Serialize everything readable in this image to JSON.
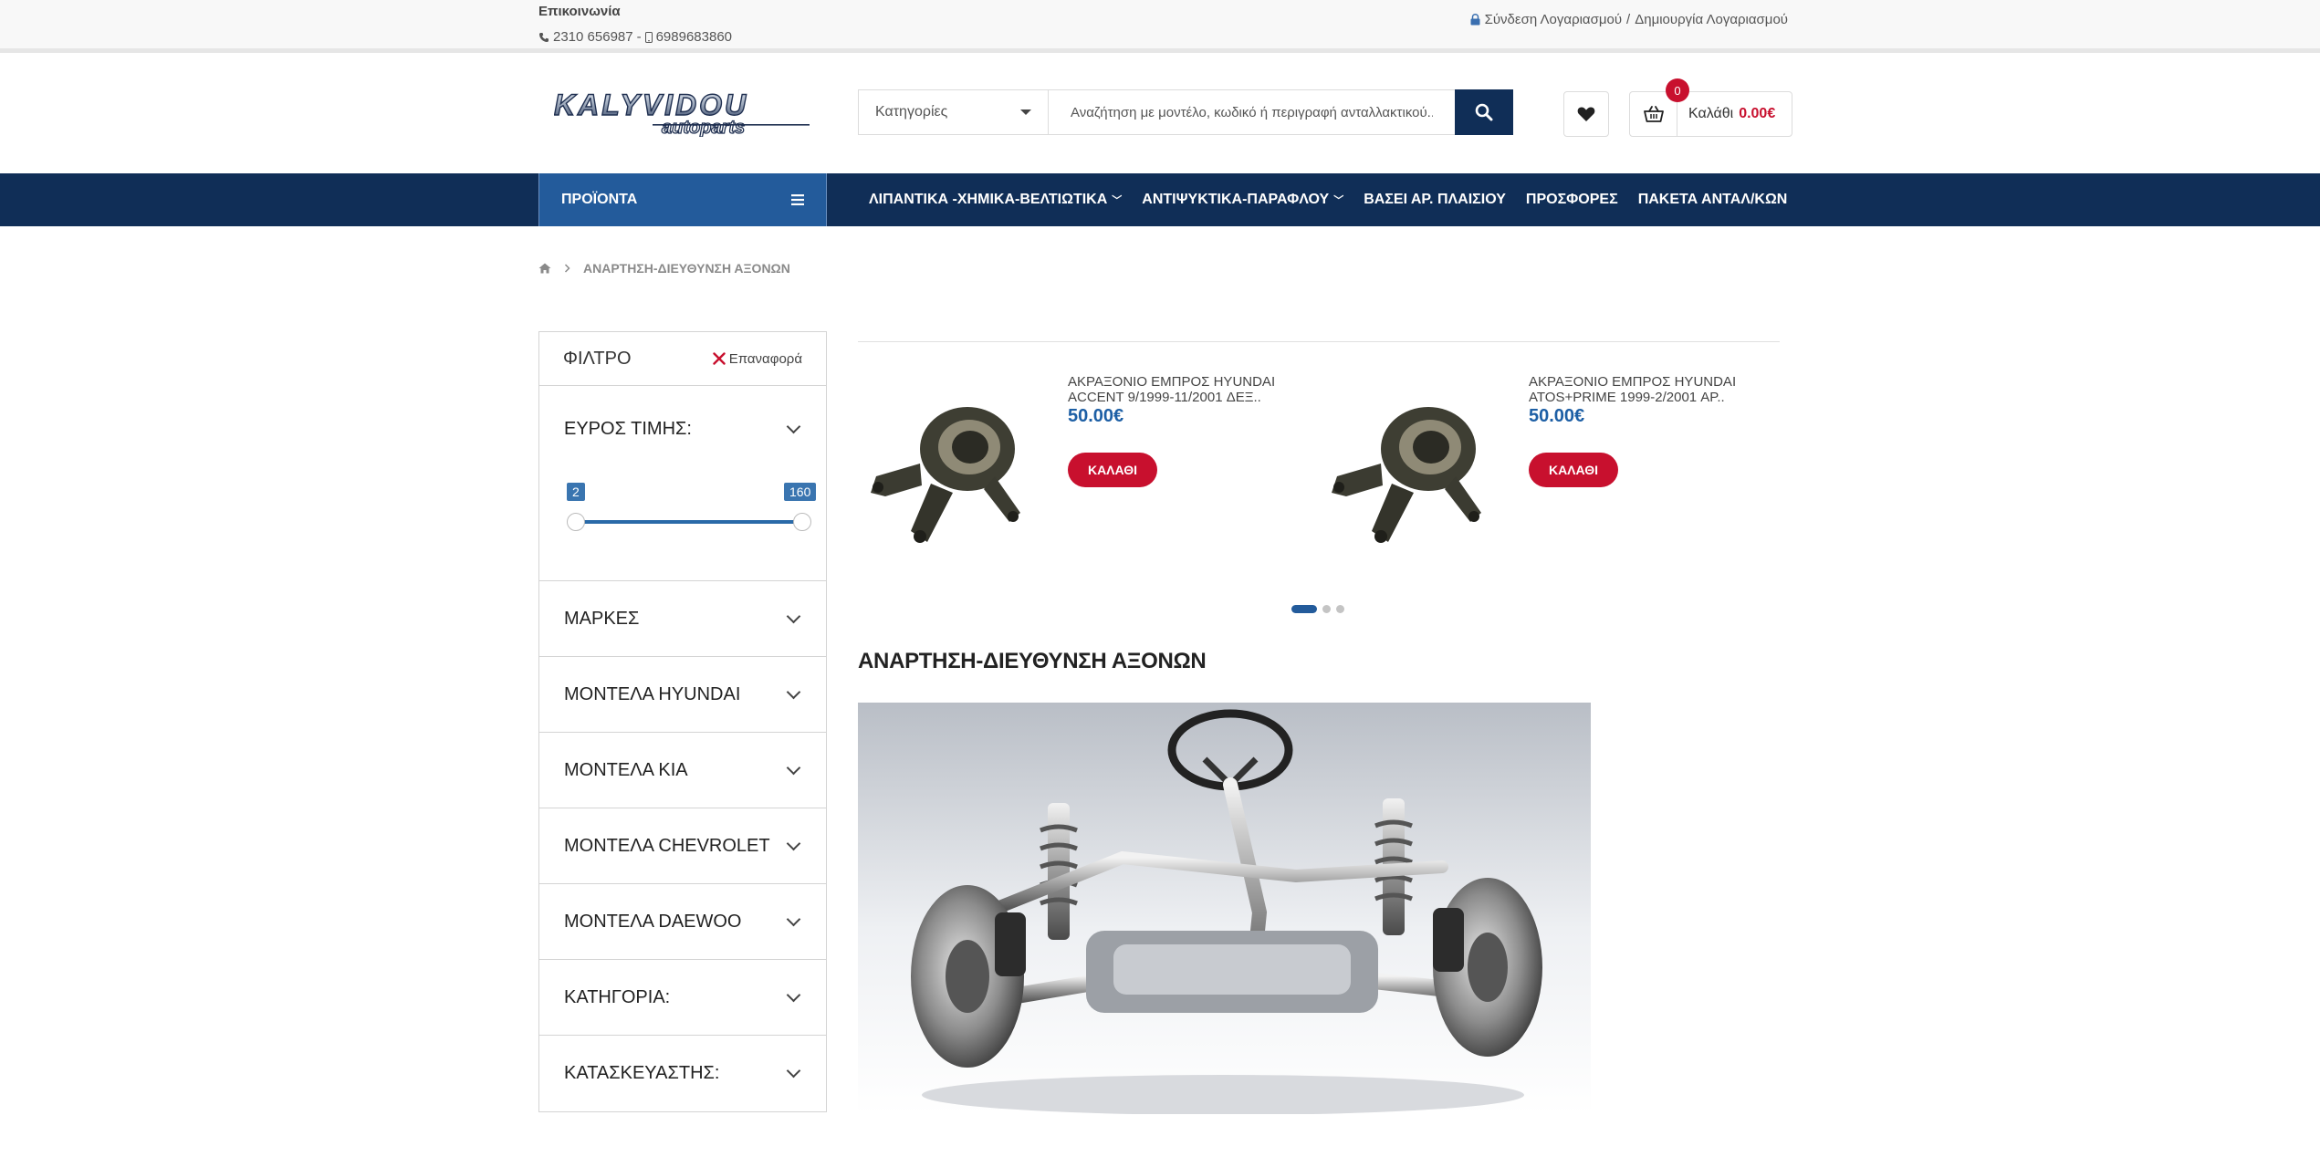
{
  "topbar": {
    "contact_title": "Επικοινωνία",
    "phone_icon": "phone-icon",
    "phone": "2310 656987",
    "mobile_icon": "mobile-icon",
    "mobile": "6989683860",
    "lock_icon": "lock-icon",
    "login_link": "Σύνδεση Λογαριασμού",
    "separator": "/",
    "register_link": "Δημιουργία Λογαριασμού"
  },
  "header": {
    "logo_top": "KALYVIDOU",
    "logo_bottom": "autoparts",
    "category_select": "Κατηγορίες",
    "search_placeholder": "Αναζήτηση με μοντέλο, κωδικό ή περιγραφή ανταλλακτικού...",
    "cart_label": "Καλάθι",
    "cart_total": "0.00€",
    "cart_count": "0"
  },
  "nav": {
    "products_label": "ΠΡΟΪΟΝΤΑ",
    "items": [
      {
        "label": "ΛΙΠΑΝΤΙΚΑ -ΧΗΜΙΚΑ-ΒΕΛΤΙΩΤΙΚΑ",
        "chevron": "﹀"
      },
      {
        "label": "ΑΝΤΙΨΥΚΤΙΚΑ-ΠΑΡΑΦΛΟΥ",
        "chevron": "﹀"
      },
      {
        "label": "ΒΑΣΕΙ ΑΡ. ΠΛΑΙΣΙΟΥ",
        "chevron": ""
      },
      {
        "label": "ΠΡΟΣΦΟΡΕΣ",
        "chevron": ""
      },
      {
        "label": "ΠΑΚΕΤΑ ΑΝΤΑΛ/ΚΩΝ",
        "chevron": ""
      }
    ]
  },
  "breadcrumb": {
    "current": "ΑΝΑΡΤΗΣΗ-ΔΙΕΥΘΥΝΣΗ ΑΞΟΝΩΝ"
  },
  "sidebar": {
    "filter_title": "ΦΙΛΤΡΟ",
    "reset_label": "Επαναφορά",
    "price_label": "ΕΥΡΟΣ ΤΙΜΗΣ:",
    "price_min": "2",
    "price_max": "160",
    "sections": [
      {
        "label": "ΜΑΡΚΕΣ"
      },
      {
        "label": "ΜΟΝΤΕΛΑ HYUNDAI"
      },
      {
        "label": "ΜΟΝΤΕΛΑ KIA"
      },
      {
        "label": "ΜΟΝΤΕΛΑ CHEVROLET"
      },
      {
        "label": "ΜΟΝΤΕΛΑ DAEWOO"
      },
      {
        "label": "ΚΑΤΗΓΟΡΙΑ:"
      },
      {
        "label": "ΚΑΤΑΣΚΕΥΑΣΤΗΣ:"
      }
    ]
  },
  "products": [
    {
      "name": "ΑΚΡΑΞΟΝΙΟ ΕΜΠΡΟΣ HYUNDAI ACCENT 9/1999-11/2001 ΔΕΞ..",
      "price": "50.00€",
      "button": "ΚΑΛΑΘΙ"
    },
    {
      "name": "ΑΚΡΑΞΟΝΙΟ ΕΜΠΡΟΣ HYUNDAI ATOS+PRIME 1999-2/2001 ΑΡ..",
      "price": "50.00€",
      "button": "ΚΑΛΑΘΙ"
    }
  ],
  "carousel": {
    "pages": 3,
    "active_page": 1
  },
  "category": {
    "heading": "ΑΝΑΡΤΗΣΗ-ΔΙΕΥΘΥΝΣΗ ΑΞΟΝΩΝ"
  },
  "colors": {
    "navy": "#102e57",
    "accent_blue": "#235b9b",
    "price_blue": "#1d5fa5",
    "red": "#c8102e"
  }
}
